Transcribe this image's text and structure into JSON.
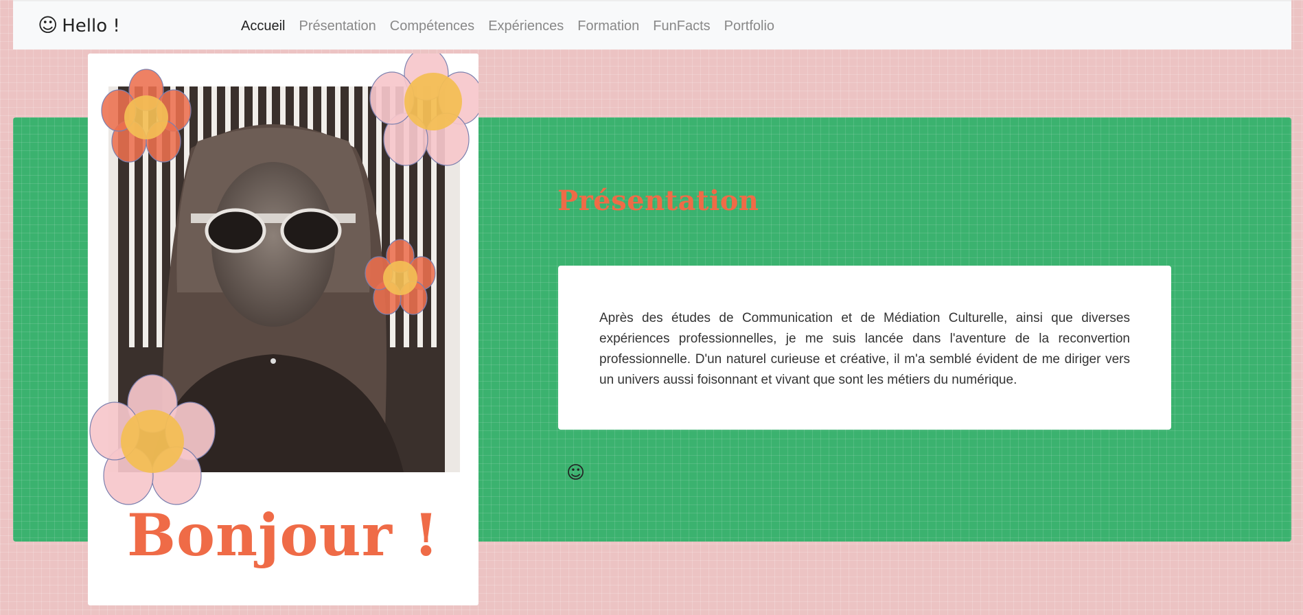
{
  "nav": {
    "brand_icon": "☺",
    "brand": "Hello !",
    "links": [
      {
        "label": "Accueil",
        "active": true
      },
      {
        "label": "Présentation",
        "active": false
      },
      {
        "label": "Compétences",
        "active": false
      },
      {
        "label": "Expériences",
        "active": false
      },
      {
        "label": "Formation",
        "active": false
      },
      {
        "label": "FunFacts",
        "active": false
      },
      {
        "label": "Portfolio",
        "active": false
      }
    ]
  },
  "hero": {
    "greeting": "Bonjour !"
  },
  "presentation": {
    "title": "Présentation",
    "text": "Après des études de Communication et de Médiation Culturelle, ainsi que diverses expériences professionnelles, je me suis lancée dans l'aventure de la reconvertion professionnelle. D'un naturel curieuse et créative, il m'a semblé évident de me diriger vers un univers aussi foisonnant et vivant que sont les métiers du numérique.",
    "footer_icon": "☺"
  },
  "colors": {
    "page_background": "#ecc3c3",
    "green_band": "#3bb26f",
    "accent_orange": "#ef6b47",
    "flower_pink": "#f6c7cb",
    "flower_orange": "#ec6f4f",
    "flower_center": "#f3be55"
  },
  "icons": {
    "brand_icon": "smiley-icon",
    "footer_icon": "smiley-icon"
  }
}
